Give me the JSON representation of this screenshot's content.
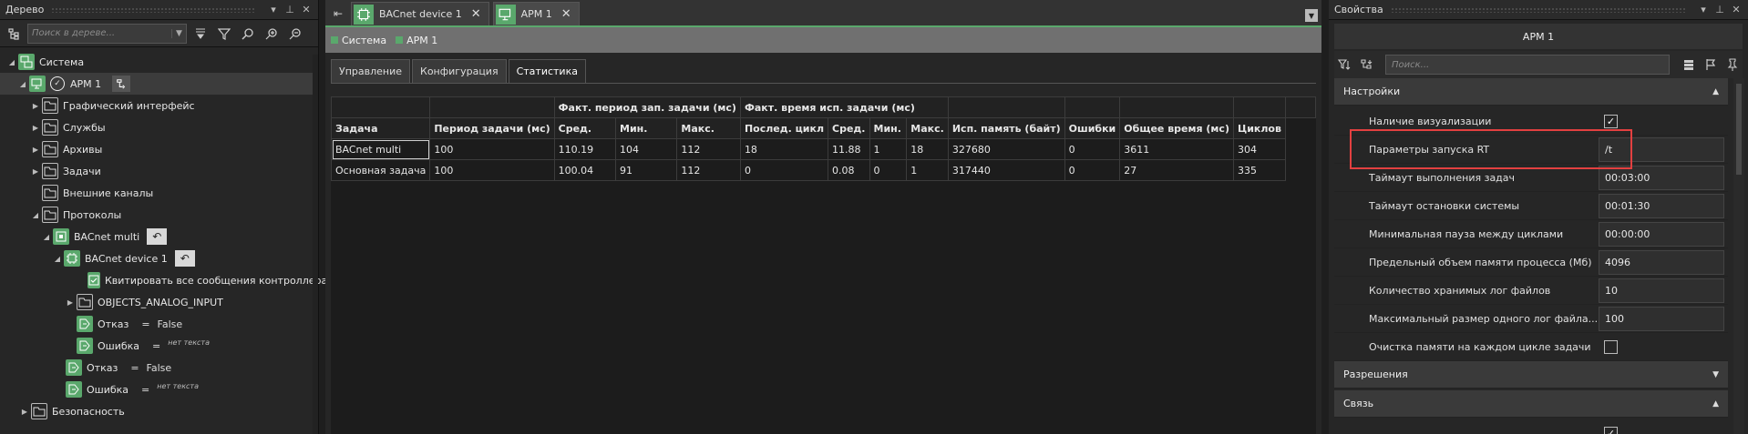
{
  "tree_panel": {
    "title": "Дерево",
    "search_placeholder": "Поиск в дереве...",
    "items": [
      {
        "label": "Система",
        "value": ""
      },
      {
        "label": "АРМ 1",
        "value": ""
      },
      {
        "label": "Графический интерфейс",
        "value": ""
      },
      {
        "label": "Службы",
        "value": ""
      },
      {
        "label": "Архивы",
        "value": ""
      },
      {
        "label": "Задачи",
        "value": ""
      },
      {
        "label": "Внешние каналы",
        "value": ""
      },
      {
        "label": "Протоколы",
        "value": ""
      },
      {
        "label": "BACnet multi",
        "value": ""
      },
      {
        "label": "BACnet device 1",
        "value": ""
      },
      {
        "label": "Квитировать все сообщения контроллера",
        "value": ""
      },
      {
        "label": "OBJECTS_ANALOG_INPUT",
        "value": ""
      },
      {
        "label": "Отказ",
        "eq": "=",
        "value": "False"
      },
      {
        "label": "Ошибка",
        "eq": "=",
        "value": "нет текста"
      },
      {
        "label": "Отказ",
        "eq": "=",
        "value": "False"
      },
      {
        "label": "Ошибка",
        "eq": "=",
        "value": "нет текста"
      },
      {
        "label": "Безопасность",
        "value": ""
      }
    ]
  },
  "center": {
    "tabs": [
      {
        "label": "BACnet device 1",
        "close": "✕"
      },
      {
        "label": "АРМ 1",
        "close": "✕"
      }
    ],
    "breadcrumb": [
      "Система",
      "АРМ 1"
    ],
    "subtabs": [
      "Управление",
      "Конфигурация",
      "Статистика"
    ],
    "stats": {
      "group_headers": [
        "Факт. период зап. задачи (мс)",
        "Факт. время исп. задачи (мс)"
      ],
      "columns": [
        "Задача",
        "Период задачи (мс)",
        "Сред.",
        "Мин.",
        "Макс.",
        "Послед. цикл",
        "Сред.",
        "Мин.",
        "Макс.",
        "Исп. память (байт)",
        "Ошибки",
        "Общее время (мс)",
        "Циклов"
      ],
      "rows": [
        [
          "BACnet multi",
          "100",
          "110.19",
          "104",
          "112",
          "18",
          "11.88",
          "1",
          "18",
          "327680",
          "0",
          "3611",
          "304"
        ],
        [
          "Основная задача",
          "100",
          "100.04",
          "91",
          "112",
          "0",
          "0.08",
          "0",
          "1",
          "317440",
          "0",
          "27",
          "335"
        ]
      ]
    }
  },
  "props_panel": {
    "title": "Свойства",
    "object_title": "АРМ 1",
    "search_placeholder": "Поиск...",
    "sections": {
      "settings": "Настройки",
      "permissions": "Разрешения",
      "connection": "Связь"
    },
    "rows": [
      {
        "name": "Наличие визуализации",
        "value": "✓"
      },
      {
        "name": "Параметры запуска RT",
        "value": "/t"
      },
      {
        "name": "Таймаут выполнения задач",
        "value": "00:03:00"
      },
      {
        "name": "Таймаут остановки системы",
        "value": "00:01:30"
      },
      {
        "name": "Минимальная пауза между циклами",
        "value": "00:00:00"
      },
      {
        "name": "Предельный объем памяти процесса (Мб)",
        "value": "4096"
      },
      {
        "name": "Количество хранимых лог файлов",
        "value": "10"
      },
      {
        "name": "Максимальный размер одного лог файла...",
        "value": "100"
      },
      {
        "name": "Очистка памяти на каждом цикле задачи",
        "value": ""
      }
    ],
    "connection_row_value": "✓"
  },
  "colors": {
    "accent_green": "#5aa86c",
    "highlight_red": "#e34040"
  }
}
